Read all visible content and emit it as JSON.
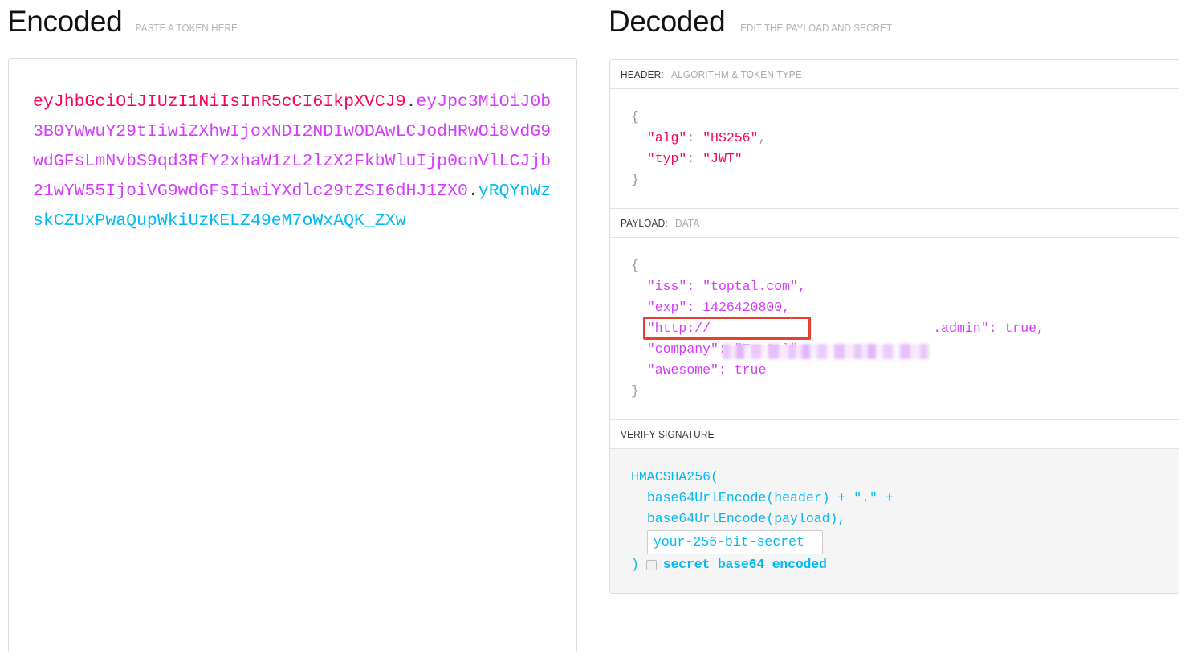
{
  "encoded": {
    "title": "Encoded",
    "subtitle": "PASTE A TOKEN HERE",
    "token": {
      "header": "eyJhbGciOiJIUzI1NiIsInR5cCI6IkpXVCJ9",
      "dot1": ".",
      "payload": "eyJpc3MiOiJ0b3B0YWwuY29tIiwiZXhwIjoxNDI2NDIwODAwLCJodHRwOi8vdG9wdGFsLmNvbS9qd3RfY2xhaW1zL2lzX2FkbWluIjp0cnVlLCJjb21wYW55IjoiVG9wdGFsIiwiYXdlc29tZSI6dHJ1ZX0",
      "dot2": ".",
      "signature": "yRQYnWzskCZUxPwaQupWkiUzKELZ49eM7oWxAQK_ZXw"
    }
  },
  "decoded": {
    "title": "Decoded",
    "subtitle": "EDIT THE PAYLOAD AND SECRET",
    "sections": {
      "header": {
        "label": "HEADER:",
        "sublabel": "ALGORITHM & TOKEN TYPE",
        "open_brace": "{",
        "close_brace": "}",
        "lines": [
          {
            "key": "\"alg\"",
            "sep": ": ",
            "value": "\"HS256\"",
            "comma": ","
          },
          {
            "key": "\"typ\"",
            "sep": ": ",
            "value": "\"JWT\"",
            "comma": ""
          }
        ]
      },
      "payload": {
        "label": "PAYLOAD:",
        "sublabel": "DATA",
        "open_brace": "{",
        "close_brace": "}",
        "lines": [
          {
            "key": "\"iss\"",
            "sep": ": ",
            "value": "\"toptal.com\"",
            "comma": ","
          },
          {
            "key": "\"exp\"",
            "sep": ": ",
            "value": "1426420800",
            "comma": ","
          },
          {
            "key": "\"http://",
            "sep": "",
            "value": ".admin\"",
            "comma": ": true,",
            "redacted": true
          },
          {
            "key": "\"company\"",
            "sep": ": ",
            "value": "\"Toptal\"",
            "comma": ","
          },
          {
            "key": "\"awesome\"",
            "sep": ": ",
            "value": "true",
            "comma": ""
          }
        ]
      },
      "signature": {
        "label": "VERIFY SIGNATURE",
        "sublabel": "",
        "line1": "HMACSHA256(",
        "line2": "base64UrlEncode(header) + \".\" +",
        "line3": "base64UrlEncode(payload),",
        "secret_value": "your-256-bit-secret",
        "secret_placeholder": "your-256-bit-secret",
        "close_paren": ")",
        "base64_label": "secret base64 encoded",
        "base64_checked": false
      }
    }
  },
  "annotation": {
    "highlight_target": "exp",
    "highlight_color": "#e8402a"
  },
  "colors": {
    "header_segment": "#fb015b",
    "payload_segment": "#d63aff",
    "signature_segment": "#00b9f1",
    "punctuation": "#999999",
    "panel_border": "#dddddd",
    "section_bg": "#f5f5f5"
  }
}
